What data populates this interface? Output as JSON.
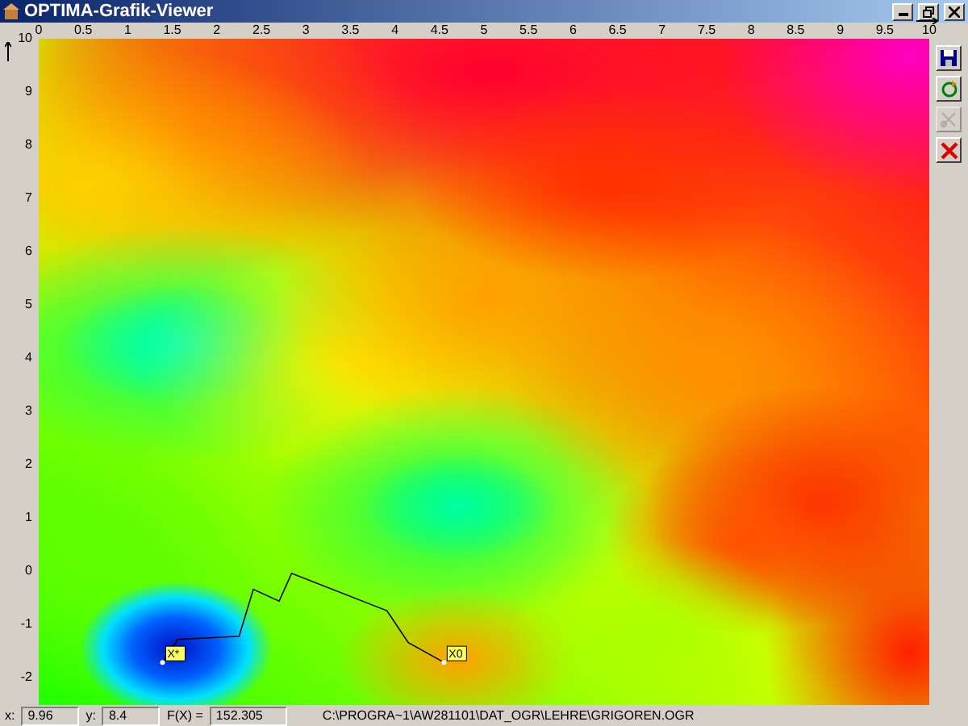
{
  "window": {
    "title": "OPTIMA-Grafik-Viewer"
  },
  "plot": {
    "chart_data": {
      "type": "line",
      "xlim": [
        0,
        10
      ],
      "ylim": [
        -2.5,
        10
      ],
      "xticks": [
        0,
        0.5,
        1,
        1.5,
        2,
        2.5,
        3,
        3.5,
        4,
        4.5,
        5,
        5.5,
        6,
        6.5,
        7,
        7.5,
        8,
        8.5,
        9,
        9.5,
        10
      ],
      "yticks": [
        10,
        9,
        8,
        7,
        6,
        5,
        4,
        3,
        2,
        1,
        0,
        -1,
        -2
      ],
      "x": [
        1.39,
        1.56,
        2.25,
        2.41,
        2.7,
        2.84,
        3.91,
        4.15,
        4.55
      ],
      "series": [
        {
          "color": "#000000",
          "values": [
            -1.7,
            -1.27,
            -1.21,
            -0.33,
            -0.55,
            -0.03,
            -0.73,
            -1.33,
            -1.7
          ]
        }
      ]
    },
    "markers": [
      {
        "label": "X*",
        "kind": "optimum"
      },
      {
        "label": "X0",
        "kind": "start"
      }
    ]
  },
  "toolbar": [
    {
      "kind": "save",
      "disabled": false
    },
    {
      "kind": "refresh",
      "disabled": false
    },
    {
      "kind": "scissors",
      "disabled": true
    },
    {
      "kind": "close",
      "disabled": false
    }
  ],
  "status_bar": {
    "x_label": "x:",
    "x_value": "9.96",
    "y_label": "y:",
    "y_value": "8.4",
    "f_label": "F(X) =",
    "f_value": "152.305",
    "file_path": "C:\\PROGRA~1\\AW281101\\DAT_OGR\\LEHRE\\GRIGOREN.OGR"
  }
}
